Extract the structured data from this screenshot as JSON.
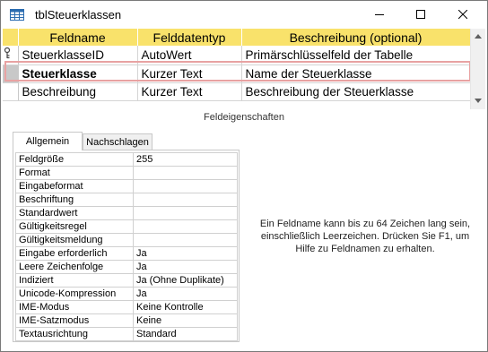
{
  "window": {
    "title": "tblSteuerklassen",
    "icon": "table-icon"
  },
  "grid": {
    "headers": [
      "Feldname",
      "Felddatentyp",
      "Beschreibung (optional)"
    ],
    "rows": [
      {
        "name": "SteuerklasseID",
        "type": "AutoWert",
        "description": "Primärschlüsselfeld der Tabelle",
        "key": true
      },
      {
        "name": "Steuerklasse",
        "type": "Kurzer Text",
        "description": "Name der Steuerklasse",
        "active": true
      },
      {
        "name": "Beschreibung",
        "type": "Kurzer Text",
        "description": "Beschreibung der Steuerklasse"
      }
    ],
    "header_color": "#f9e26b",
    "highlight_color": "#e8a2a2"
  },
  "field_properties": {
    "section_label": "Feldeigenschaften",
    "tabs": [
      "Allgemein",
      "Nachschlagen"
    ],
    "active_tab": "Allgemein",
    "properties": [
      {
        "name": "Feldgröße",
        "value": "255"
      },
      {
        "name": "Format",
        "value": ""
      },
      {
        "name": "Eingabeformat",
        "value": ""
      },
      {
        "name": "Beschriftung",
        "value": ""
      },
      {
        "name": "Standardwert",
        "value": ""
      },
      {
        "name": "Gültigkeitsregel",
        "value": ""
      },
      {
        "name": "Gültigkeitsmeldung",
        "value": ""
      },
      {
        "name": "Eingabe erforderlich",
        "value": "Ja"
      },
      {
        "name": "Leere Zeichenfolge",
        "value": "Ja"
      },
      {
        "name": "Indiziert",
        "value": "Ja (Ohne Duplikate)"
      },
      {
        "name": "Unicode-Kompression",
        "value": "Ja"
      },
      {
        "name": "IME-Modus",
        "value": "Keine Kontrolle"
      },
      {
        "name": "IME-Satzmodus",
        "value": "Keine"
      },
      {
        "name": "Textausrichtung",
        "value": "Standard"
      }
    ],
    "help_text": "Ein Feldname kann bis zu 64 Zeichen lang sein, einschließlich Leerzeichen. Drücken Sie F1, um Hilfe zu Feldnamen zu erhalten."
  }
}
